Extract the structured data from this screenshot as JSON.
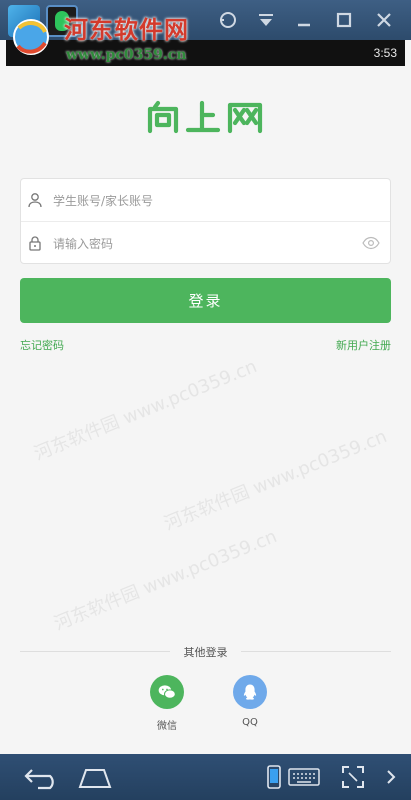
{
  "status_bar": {
    "time": "3:53"
  },
  "watermark": {
    "title": "河东软件网",
    "url": "www.pc0359.cn",
    "faint_text": "河东软件园 www.pc0359.cn"
  },
  "app": {
    "logo_text": "向上网",
    "username": {
      "placeholder": "学生账号/家长账号",
      "value": ""
    },
    "password": {
      "placeholder": "请输入密码",
      "value": ""
    },
    "login_label": "登录",
    "forgot_label": "忘记密码",
    "register_label": "新用户注册",
    "other_login_title": "其他登录",
    "social": [
      {
        "label": "微信"
      },
      {
        "label": "QQ"
      }
    ]
  },
  "colors": {
    "brand_green": "#4db55d",
    "qq_blue": "#6fa9ea",
    "emulator_chrome": "#2d4b6c"
  }
}
